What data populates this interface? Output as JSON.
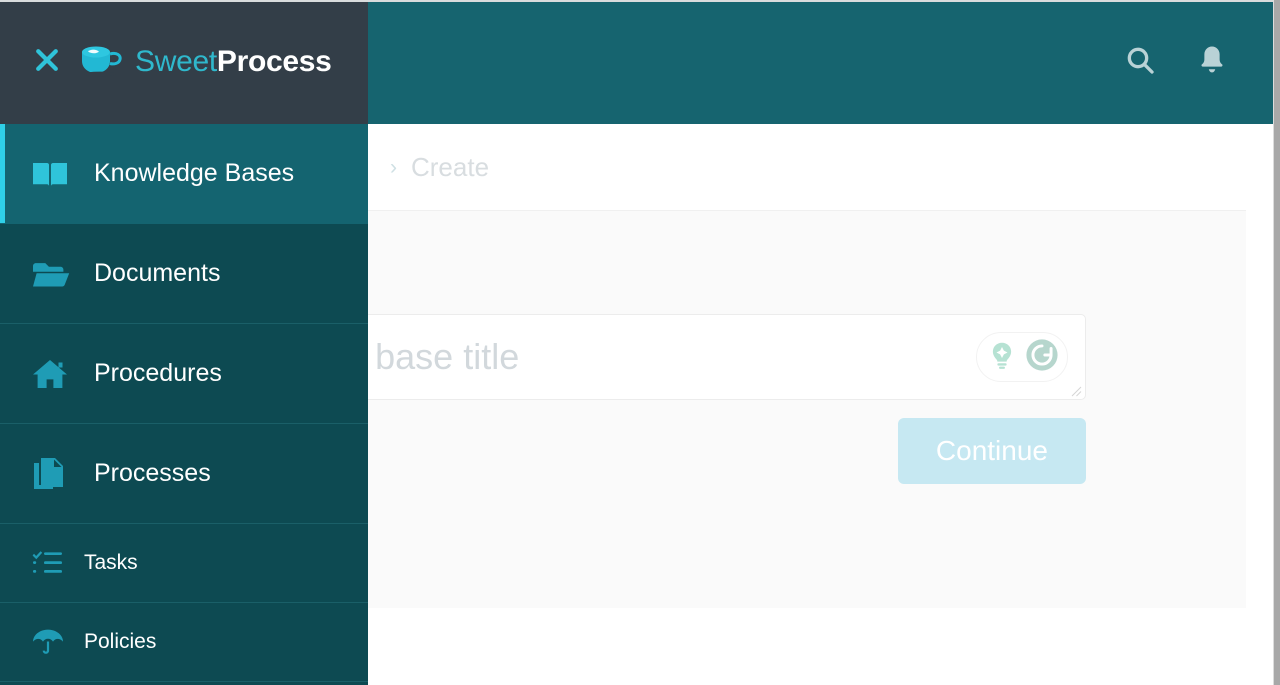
{
  "brand": {
    "close_icon": "close-x-icon",
    "logo_icon": "coffee-cup-icon",
    "name_part1": "Sweet",
    "name_part2": "Process",
    "accent_cyan": "#2fb8cc",
    "header_teal": "#16646f",
    "logo_zone_dark": "#333e48"
  },
  "topbar": {
    "search_icon": "search-icon",
    "notifications_icon": "bell-icon"
  },
  "sidebar": {
    "background": "#0d4a52",
    "active_background": "#146470",
    "active_accent": "#2fd0e8",
    "items": [
      {
        "label": "Knowledge Bases",
        "icon": "book-open-icon",
        "active": true,
        "size": "large"
      },
      {
        "label": "Documents",
        "icon": "folder-open-icon",
        "active": false,
        "size": "large"
      },
      {
        "label": "Procedures",
        "icon": "home-icon",
        "active": false,
        "size": "large"
      },
      {
        "label": "Processes",
        "icon": "copy-files-icon",
        "active": false,
        "size": "large"
      },
      {
        "label": "Tasks",
        "icon": "checklist-icon",
        "active": false,
        "size": "small"
      },
      {
        "label": "Policies",
        "icon": "umbrella-icon",
        "active": false,
        "size": "small"
      }
    ]
  },
  "breadcrumb": {
    "separator": "›",
    "current": "Create"
  },
  "main": {
    "card_background": "#fafafa",
    "title_field": {
      "value": "",
      "placeholder": "Knowledge base title",
      "suggest_icon": "lightbulb-sparkle-icon",
      "regenerate_icon": "refresh-circle-icon",
      "resize_handle": "resize-grip-icon"
    },
    "continue_button": {
      "label": "Continue",
      "background": "#c6e8f2",
      "text_color": "#ffffff"
    }
  }
}
